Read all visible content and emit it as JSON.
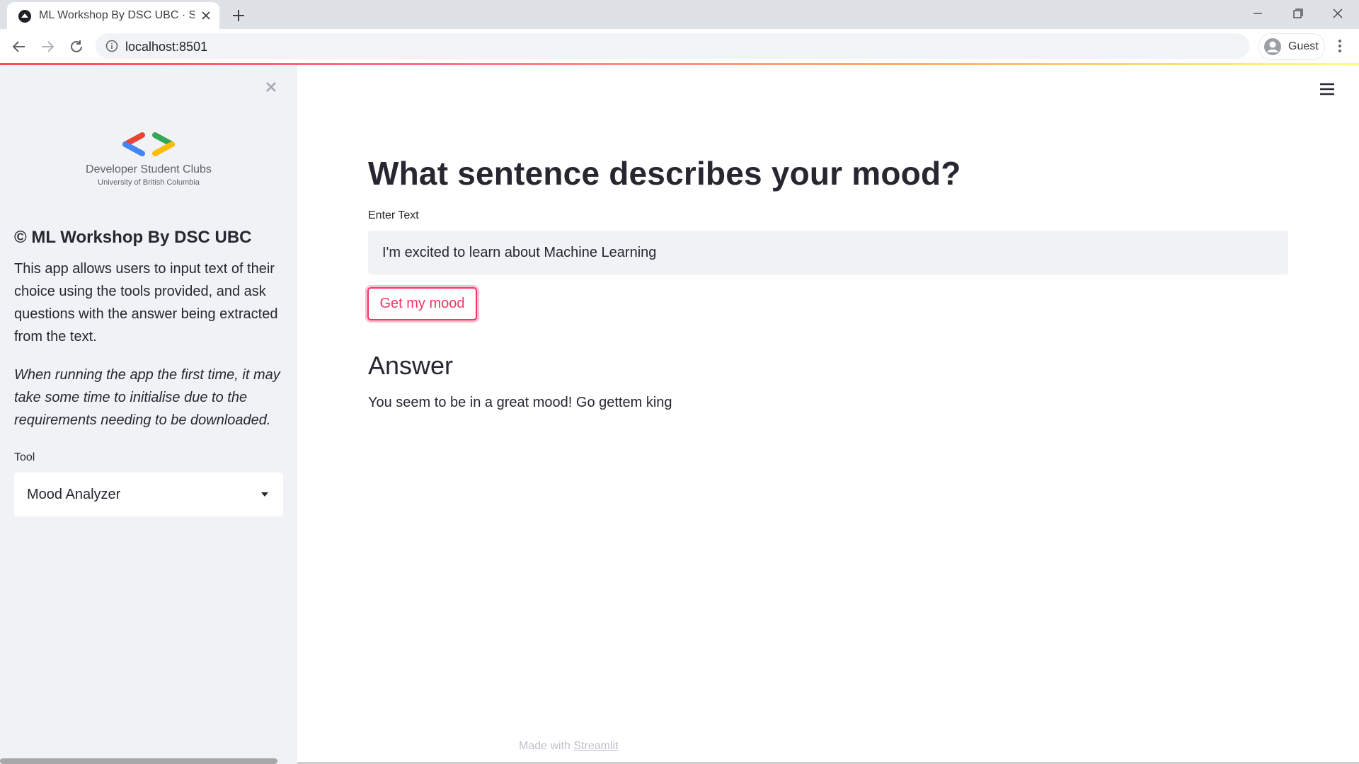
{
  "browser": {
    "tab_title": "ML Workshop By DSC UBC · Streamlit",
    "url": "localhost:8501",
    "profile_label": "Guest"
  },
  "sidebar": {
    "logo": {
      "name": "Developer Student Clubs",
      "subname": "University of British Columbia"
    },
    "title": "© ML Workshop By DSC UBC",
    "description": "This app allows users to input text of their choice using the tools provided, and ask questions with the answer being extracted from the text.",
    "note": "When running the app the first time, it may take some time to initialise due to the requirements needing to be downloaded.",
    "tool_label": "Tool",
    "tool_selected": "Mood Analyzer"
  },
  "main": {
    "title": "What sentence describes your mood?",
    "input_label": "Enter Text",
    "input_value": "I'm excited to learn about Machine Learning",
    "button_label": "Get my mood",
    "answer_heading": "Answer",
    "answer_text": "You seem to be in a great mood! Go gettem king"
  },
  "footer": {
    "made_with": "Made with",
    "link": "Streamlit"
  },
  "colors": {
    "accent": "#f63366",
    "sidebar_bg": "#f0f2f6",
    "text": "#262730",
    "chrome_bg": "#dee1e6"
  },
  "icons": [
    "streamlit-favicon-icon",
    "tab-close-icon",
    "new-tab-icon",
    "minimize-icon",
    "restore-icon",
    "window-close-icon",
    "back-arrow-icon",
    "forward-arrow-icon",
    "reload-icon",
    "info-icon",
    "profile-avatar-icon",
    "kebab-menu-icon",
    "sidebar-close-icon",
    "dsc-logo-icon",
    "caret-down-icon",
    "hamburger-menu-icon"
  ]
}
